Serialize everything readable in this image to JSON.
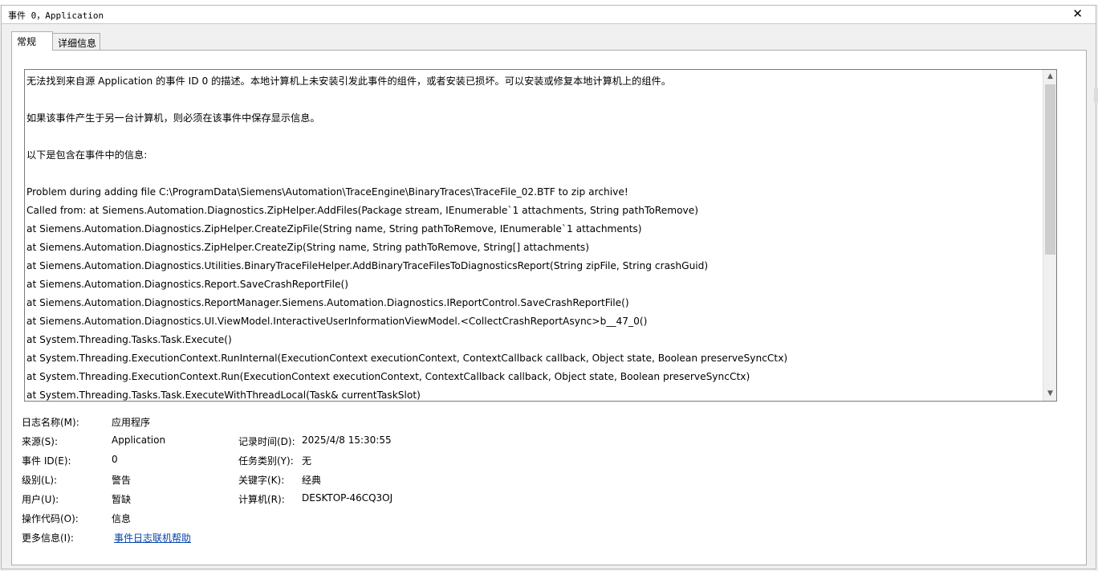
{
  "window": {
    "title": "事件 0，Application",
    "close_glyph": "✕"
  },
  "tabs": [
    {
      "label": "常规",
      "active": true
    },
    {
      "label": "详细信息",
      "active": false
    }
  ],
  "description_lines": [
    "无法找到来自源 Application 的事件 ID 0 的描述。本地计算机上未安装引发此事件的组件，或者安装已损坏。可以安装或修复本地计算机上的组件。",
    "",
    "如果该事件产生于另一台计算机，则必须在该事件中保存显示信息。",
    "",
    "以下是包含在事件中的信息:",
    "",
    "Problem during adding file C:\\ProgramData\\Siemens\\Automation\\TraceEngine\\BinaryTraces\\TraceFile_02.BTF to zip archive!",
    "Called from:     at Siemens.Automation.Diagnostics.ZipHelper.AddFiles(Package stream, IEnumerable`1 attachments, String pathToRemove)",
    "    at Siemens.Automation.Diagnostics.ZipHelper.CreateZipFile(String name, String pathToRemove, IEnumerable`1 attachments)",
    "    at Siemens.Automation.Diagnostics.ZipHelper.CreateZip(String name, String pathToRemove, String[] attachments)",
    "    at Siemens.Automation.Diagnostics.Utilities.BinaryTraceFileHelper.AddBinaryTraceFilesToDiagnosticsReport(String zipFile, String crashGuid)",
    "    at Siemens.Automation.Diagnostics.Report.SaveCrashReportFile()",
    "    at Siemens.Automation.Diagnostics.ReportManager.Siemens.Automation.Diagnostics.IReportControl.SaveCrashReportFile()",
    "    at Siemens.Automation.Diagnostics.UI.ViewModel.InteractiveUserInformationViewModel.<CollectCrashReportAsync>b__47_0()",
    "    at System.Threading.Tasks.Task.Execute()",
    "    at System.Threading.ExecutionContext.RunInternal(ExecutionContext executionContext, ContextCallback callback, Object state, Boolean preserveSyncCtx)",
    "    at System.Threading.ExecutionContext.Run(ExecutionContext executionContext, ContextCallback callback, Object state, Boolean preserveSyncCtx)",
    "    at System.Threading.Tasks.Task.ExecuteWithThreadLocal(Task& currentTaskSlot)"
  ],
  "scrollbar": {
    "up_glyph": "▲",
    "down_glyph": "▼"
  },
  "fields": {
    "log_name": {
      "label": "日志名称(M):",
      "value": "应用程序"
    },
    "source": {
      "label": "来源(S):",
      "value": "Application"
    },
    "logged": {
      "label": "记录时间(D):",
      "value": "2025/4/8 15:30:55"
    },
    "event_id": {
      "label": "事件 ID(E):",
      "value": "0"
    },
    "task_category": {
      "label": "任务类别(Y):",
      "value": "无"
    },
    "level": {
      "label": "级别(L):",
      "value": "警告"
    },
    "keywords": {
      "label": "关键字(K):",
      "value": "经典"
    },
    "user": {
      "label": "用户(U):",
      "value": "暂缺"
    },
    "computer": {
      "label": "计算机(R):",
      "value": "DESKTOP-46CQ3OJ"
    },
    "opcode": {
      "label": "操作代码(O):",
      "value": "信息"
    },
    "more_info": {
      "label": "更多信息(I):",
      "value": "事件日志联机帮助"
    }
  }
}
